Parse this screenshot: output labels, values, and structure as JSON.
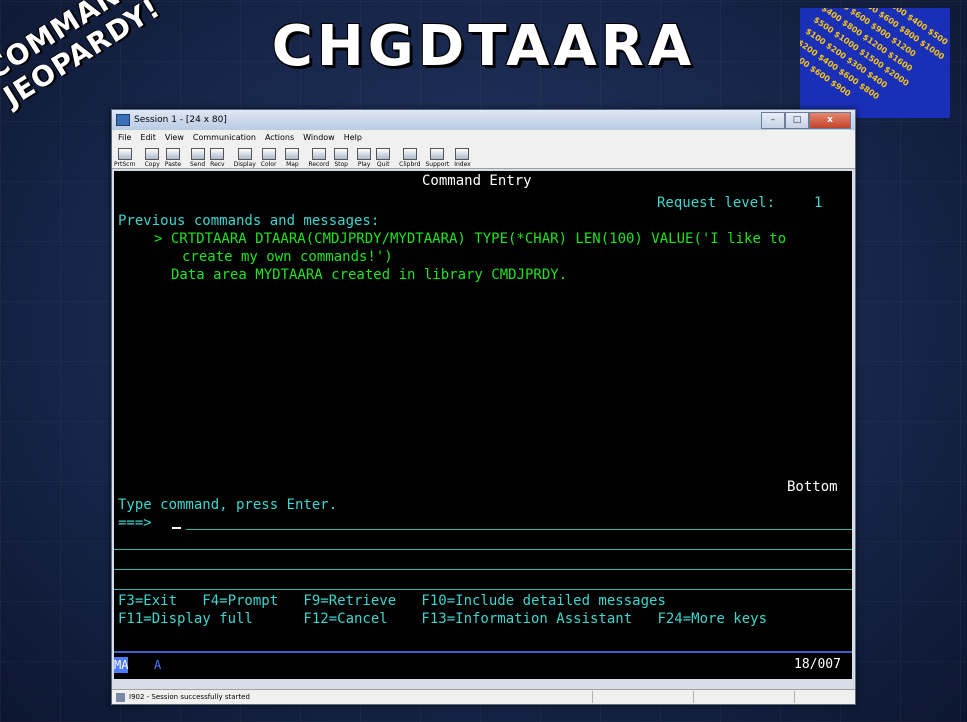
{
  "slide": {
    "title": "CHGDTAARA",
    "logo_line1": "COMMAND",
    "logo_line2": "JEOPARDY!",
    "board_values": [
      "$100",
      "$200",
      "$300",
      "$400",
      "$500",
      "$1000"
    ]
  },
  "window": {
    "title": "Session 1 - [24 x 80]",
    "menu": [
      "File",
      "Edit",
      "View",
      "Communication",
      "Actions",
      "Window",
      "Help"
    ],
    "toolbar": [
      "PrtScrn",
      "Copy",
      "Paste",
      "Send",
      "Recv",
      "Display",
      "Color",
      "Map",
      "Record",
      "Stop",
      "Play",
      "Quit",
      "Clipbrd",
      "Support",
      "Index"
    ]
  },
  "screen": {
    "header": "Command Entry",
    "request_label": "Request level:",
    "request_value": "1",
    "prev_label": "Previous commands and messages:",
    "cmd_line1": "> CRTDTAARA DTAARA(CMDJPRDY/MYDTAARA) TYPE(*CHAR) LEN(100) VALUE('I like to",
    "cmd_line2": "create my own commands!')",
    "message": "Data area MYDTAARA created in library CMDJPRDY.",
    "bottom": "Bottom",
    "prompt_label": "Type command, press Enter.",
    "prompt_arrow": "===>",
    "fkeys1": "F3=Exit   F4=Prompt   F9=Retrieve   F10=Include detailed messages",
    "fkeys2": "F11=Display full      F12=Cancel    F13=Information Assistant   F24=More keys",
    "oia_mode": "MA",
    "oia_a": "A",
    "oia_pos": "18/007"
  },
  "status": {
    "text": "I902 - Session successfully started"
  }
}
